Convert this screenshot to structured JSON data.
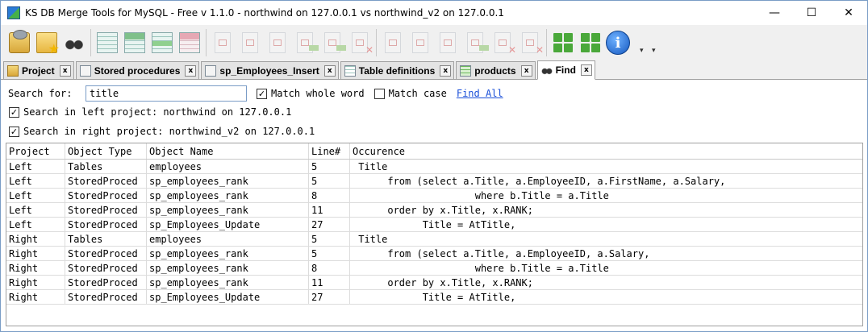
{
  "window": {
    "title": "KS DB Merge Tools for MySQL - Free v 1.1.0 - northwind on 127.0.0.1 vs northwind_v2 on 127.0.0.1"
  },
  "window_controls": {
    "minimize": "—",
    "maximize": "☐",
    "close": "✕"
  },
  "tabs": [
    {
      "label": "Project",
      "icon": "project-icon",
      "close": "x"
    },
    {
      "label": "Stored procedures",
      "icon": "list-icon",
      "close": "x"
    },
    {
      "label": "sp_Employees_Insert",
      "icon": "list-icon",
      "close": "x"
    },
    {
      "label": "Table definitions",
      "icon": "grid-icon",
      "close": "x"
    },
    {
      "label": "products",
      "icon": "table-icon",
      "close": "x"
    },
    {
      "label": "Find",
      "icon": "binoculars-icon",
      "close": "x"
    }
  ],
  "find": {
    "search_label": "Search for:",
    "search_value": "title",
    "match_whole_word": {
      "label": "Match whole word",
      "checked": "✓"
    },
    "match_case": {
      "label": "Match case",
      "checked": ""
    },
    "find_all": "Find All",
    "left_scope": {
      "label": "Search in left project: northwind on 127.0.0.1",
      "checked": "✓"
    },
    "right_scope": {
      "label": "Search in right project: northwind_v2 on 127.0.0.1",
      "checked": "✓"
    }
  },
  "results": {
    "columns": [
      "Project",
      "Object Type",
      "Object Name",
      "Line#",
      "Occurence"
    ],
    "rows": [
      [
        "Left",
        "Tables",
        "employees",
        "5",
        " Title"
      ],
      [
        "Left",
        "StoredProced",
        "sp_employees_rank",
        "5",
        "      from (select a.Title, a.EmployeeID, a.FirstName, a.Salary,"
      ],
      [
        "Left",
        "StoredProced",
        "sp_employees_rank",
        "8",
        "                     where b.Title = a.Title"
      ],
      [
        "Left",
        "StoredProced",
        "sp_employees_rank",
        "11",
        "      order by x.Title, x.RANK;"
      ],
      [
        "Left",
        "StoredProced",
        "sp_Employees_Update",
        "27",
        "            Title = AtTitle,"
      ],
      [
        "Right",
        "Tables",
        "employees",
        "5",
        " Title"
      ],
      [
        "Right",
        "StoredProced",
        "sp_employees_rank",
        "5",
        "      from (select a.Title, a.EmployeeID, a.Salary,"
      ],
      [
        "Right",
        "StoredProced",
        "sp_employees_rank",
        "8",
        "                     where b.Title = a.Title"
      ],
      [
        "Right",
        "StoredProced",
        "sp_employees_rank",
        "11",
        "      order by x.Title, x.RANK;"
      ],
      [
        "Right",
        "StoredProced",
        "sp_Employees_Update",
        "27",
        "            Title = AtTitle,"
      ]
    ]
  }
}
